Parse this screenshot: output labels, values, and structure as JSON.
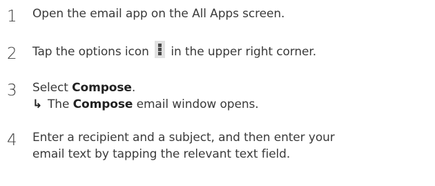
{
  "steps": [
    {
      "number": "1",
      "text": "Open the email app on the All Apps screen."
    },
    {
      "number": "2",
      "text_before_icon": "Tap the options icon",
      "icon": "options-menu-icon",
      "text_after_icon": "in the upper right corner."
    },
    {
      "number": "3",
      "text_prefix": "Select ",
      "bold_term": "Compose",
      "text_suffix": ".",
      "result": {
        "arrow": "↳",
        "prefix": "The ",
        "bold_term": "Compose",
        "suffix": " email window opens."
      }
    },
    {
      "number": "4",
      "line1": "Enter a recipient and a subject, and then enter your",
      "line2": "email text by tapping the relevant text field."
    }
  ]
}
